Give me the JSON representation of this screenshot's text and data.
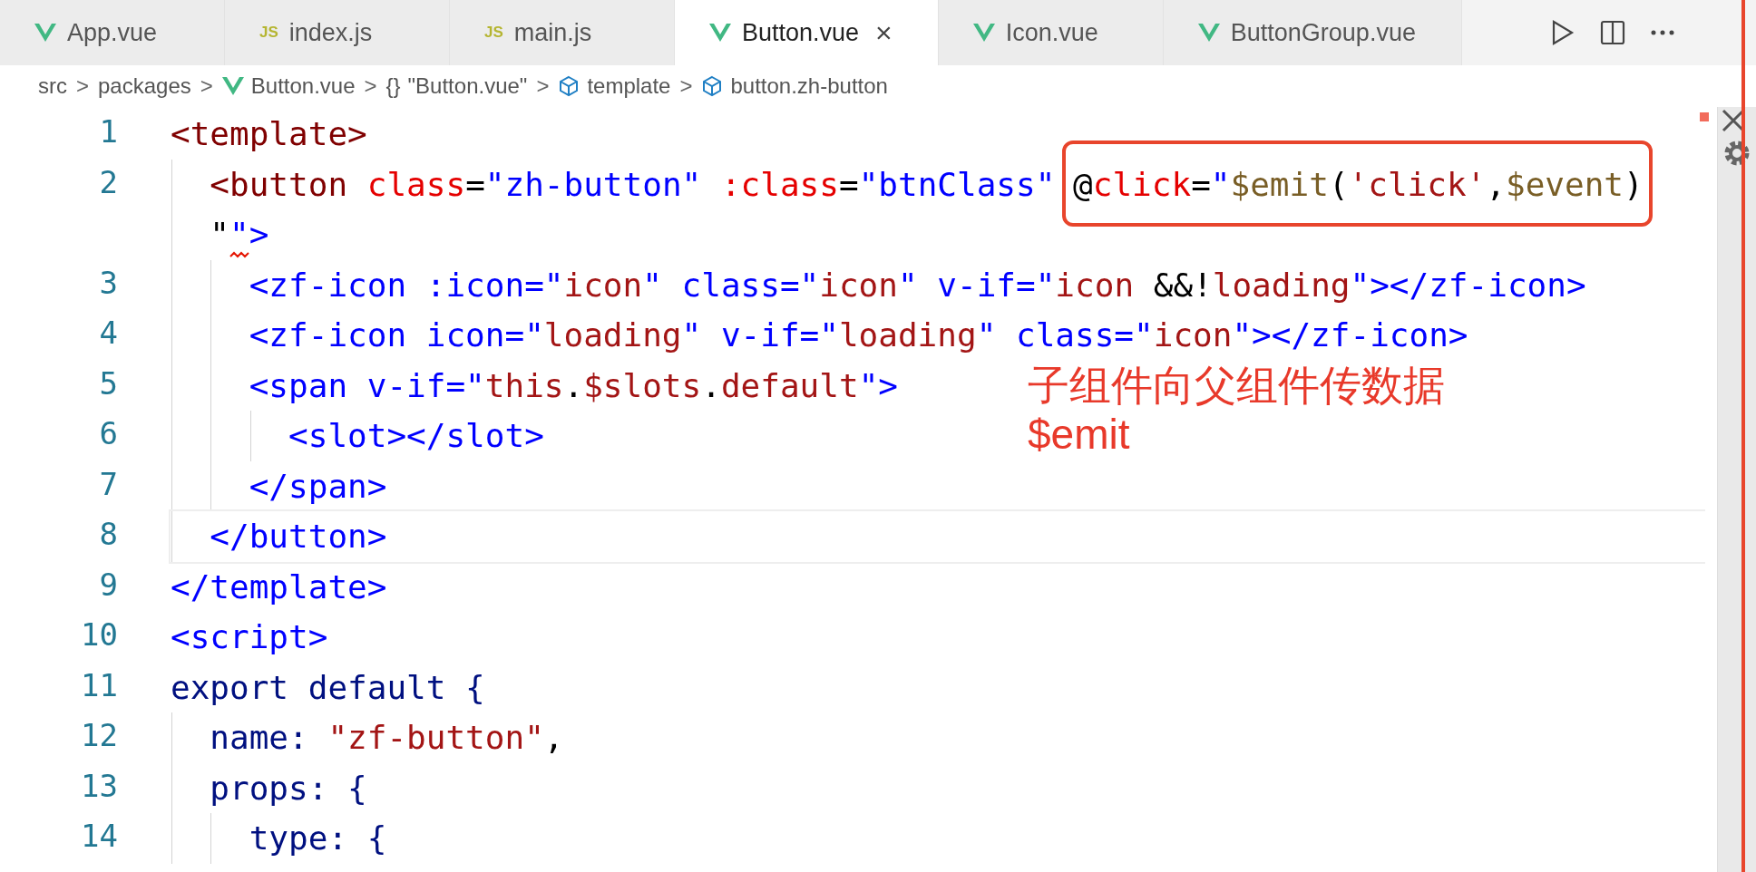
{
  "tabs": [
    {
      "label": "App.vue",
      "kind": "vue",
      "selected": false
    },
    {
      "label": "index.js",
      "kind": "js",
      "icon_text": "JS",
      "selected": false
    },
    {
      "label": "main.js",
      "kind": "js",
      "icon_text": "JS",
      "selected": false
    },
    {
      "label": "Button.vue",
      "kind": "vue",
      "selected": true,
      "close": "×"
    },
    {
      "label": "Icon.vue",
      "kind": "vue",
      "selected": false
    },
    {
      "label": "ButtonGroup.vue",
      "kind": "vue",
      "selected": false
    }
  ],
  "breadcrumb": [
    {
      "label": "src"
    },
    {
      "label": "packages"
    },
    {
      "label": "Button.vue",
      "kind": "vue"
    },
    {
      "label": "\"Button.vue\"",
      "kind": "braces",
      "icon_text": "{}"
    },
    {
      "label": "template",
      "kind": "cube"
    },
    {
      "label": "button.zh-button",
      "kind": "cube"
    }
  ],
  "separator": ">",
  "lines": [
    {
      "number": "1",
      "current": false,
      "tokens": [
        {
          "kind": "tag",
          "text": "<template>"
        }
      ]
    },
    {
      "number": "2",
      "current": false,
      "tokens": [
        {
          "kind": "tag",
          "text": "  <button"
        },
        {
          "kind": "attr",
          "text": " class"
        },
        {
          "kind": "plain",
          "text": "="
        },
        {
          "kind": "markup",
          "text": "\"zh-button\""
        },
        {
          "kind": "attr",
          "text": " :class"
        },
        {
          "kind": "plain",
          "text": "="
        },
        {
          "kind": "markup",
          "text": "\"btnClass\" "
        }
      ],
      "boxed": [
        {
          "kind": "plain",
          "text": "@"
        },
        {
          "kind": "attr",
          "text": "click"
        },
        {
          "kind": "plain",
          "text": "="
        },
        {
          "kind": "markup",
          "text": "\""
        },
        {
          "kind": "ident",
          "text": "$emit"
        },
        {
          "kind": "plain",
          "text": "("
        },
        {
          "kind": "string",
          "text": "'click'"
        },
        {
          "kind": "plain",
          "text": ","
        },
        {
          "kind": "ident",
          "text": "$event"
        },
        {
          "kind": "plain",
          "text": ")"
        }
      ]
    },
    {
      "current": false,
      "tokens": [
        {
          "kind": "plain",
          "text": "  \""
        },
        {
          "kind": "markup",
          "text": "\"",
          "error": true
        },
        {
          "kind": "markup",
          "text": ">"
        }
      ]
    },
    {
      "number": "3",
      "current": false,
      "tokens": [
        {
          "kind": "markup",
          "text": "    <zf-icon :icon=\""
        },
        {
          "kind": "string",
          "text": "icon"
        },
        {
          "kind": "markup",
          "text": "\" class=\""
        },
        {
          "kind": "string",
          "text": "icon"
        },
        {
          "kind": "markup",
          "text": "\" v-if=\""
        },
        {
          "kind": "string",
          "text": "icon"
        },
        {
          "kind": "plain",
          "text": " &&!"
        },
        {
          "kind": "string",
          "text": "loading"
        },
        {
          "kind": "markup",
          "text": "\"></zf-icon>"
        }
      ]
    },
    {
      "number": "4",
      "current": false,
      "tokens": [
        {
          "kind": "markup",
          "text": "    <zf-icon icon=\""
        },
        {
          "kind": "string",
          "text": "loading"
        },
        {
          "kind": "markup",
          "text": "\" v-if=\""
        },
        {
          "kind": "string",
          "text": "loading"
        },
        {
          "kind": "markup",
          "text": "\" class=\""
        },
        {
          "kind": "string",
          "text": "icon"
        },
        {
          "kind": "markup",
          "text": "\"></zf-icon>"
        }
      ]
    },
    {
      "number": "5",
      "current": false,
      "tokens": [
        {
          "kind": "markup",
          "text": "    <span v-if=\""
        },
        {
          "kind": "string",
          "text": "this"
        },
        {
          "kind": "plain",
          "text": "."
        },
        {
          "kind": "string",
          "text": "$slots"
        },
        {
          "kind": "plain",
          "text": "."
        },
        {
          "kind": "string",
          "text": "default"
        },
        {
          "kind": "markup",
          "text": "\">"
        }
      ]
    },
    {
      "number": "6",
      "current": false,
      "tokens": [
        {
          "kind": "markup",
          "text": "      <slot></slot>"
        }
      ]
    },
    {
      "number": "7",
      "current": false,
      "tokens": [
        {
          "kind": "markup",
          "text": "    </span>"
        }
      ]
    },
    {
      "number": "8",
      "current": true,
      "tokens": [
        {
          "kind": "markup",
          "text": "  </button>"
        }
      ]
    },
    {
      "number": "9",
      "current": false,
      "tokens": [
        {
          "kind": "markup",
          "text": "</template>"
        }
      ]
    },
    {
      "number": "10",
      "current": false,
      "tokens": [
        {
          "kind": "markup",
          "text": "<script>"
        }
      ]
    },
    {
      "number": "11",
      "current": false,
      "tokens": [
        {
          "kind": "keyword",
          "text": "export default {"
        }
      ]
    },
    {
      "number": "12",
      "current": false,
      "tokens": [
        {
          "kind": "keyword",
          "text": "  name: "
        },
        {
          "kind": "string",
          "text": "\"zf-button\""
        },
        {
          "kind": "plain",
          "text": ","
        }
      ]
    },
    {
      "number": "13",
      "current": false,
      "tokens": [
        {
          "kind": "keyword",
          "text": "  props: {"
        }
      ]
    },
    {
      "number": "14",
      "current": false,
      "tokens": [
        {
          "kind": "keyword",
          "text": "    type: {"
        }
      ]
    }
  ],
  "note": [
    "子组件向父组件传数据",
    "$emit"
  ]
}
